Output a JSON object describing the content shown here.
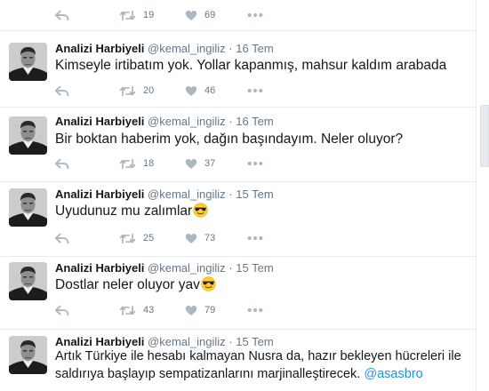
{
  "top_actions": {
    "retweets": "19",
    "likes": "69"
  },
  "tweets": [
    {
      "name": "Analizi Harbiyeli",
      "handle": "@kemal_ingiliz",
      "dot": "·",
      "time": "16 Tem",
      "text": "Kimseyle irtibatım yok. Yollar kapanmış, mahsur kaldım arabada",
      "retweets": "20",
      "likes": "46"
    },
    {
      "name": "Analizi Harbiyeli",
      "handle": "@kemal_ingiliz",
      "dot": "·",
      "time": "16 Tem",
      "text": "Bir boktan haberim yok, dağın başındayım. Neler oluyor?",
      "retweets": "18",
      "likes": "37"
    },
    {
      "name": "Analizi Harbiyeli",
      "handle": "@kemal_ingiliz",
      "dot": "·",
      "time": "15 Tem",
      "text": "Uyudunuz mu zalımlar",
      "emoji": "smiling-face-with-sunglasses",
      "retweets": "25",
      "likes": "73"
    },
    {
      "name": "Analizi Harbiyeli",
      "handle": "@kemal_ingiliz",
      "dot": "·",
      "time": "15 Tem",
      "text": "Dostlar neler oluyor yav",
      "emoji": "smiling-face-with-sunglasses",
      "retweets": "43",
      "likes": "79"
    },
    {
      "name": "Analizi Harbiyeli",
      "handle": "@kemal_ingiliz",
      "dot": "·",
      "time": "15 Tem",
      "text_line1": "Artık Türkiye ile hesabı kalmayan Nusra da, hazır bekleyen hücreleri ile",
      "text_line2": "saldırıya başlayıp sempatizanlarını marjinalleştirecek.",
      "mention": "@asasbro"
    }
  ],
  "icons": {
    "reply": "reply-icon",
    "retweet": "retweet-icon",
    "like": "heart-icon",
    "more": "more-dots-icon",
    "emoji": "sunglasses-emoji-icon"
  },
  "colors": {
    "icon": "#aab8c2",
    "count": "#657786",
    "mention": "#1b95e0",
    "border": "#e6ecf0"
  }
}
